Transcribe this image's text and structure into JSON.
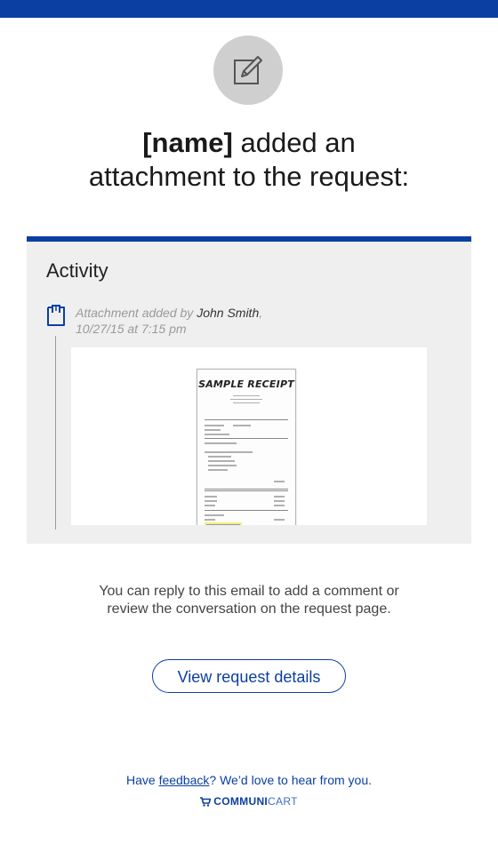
{
  "header": {
    "icon": "edit-icon",
    "name_placeholder": "[name]",
    "headline_rest": " added an",
    "headline_line2": "attachment to the request:"
  },
  "activity": {
    "title": "Activity",
    "icon": "clipboard-icon",
    "entry_prefix": "Attachment added by ",
    "author": "John Smith",
    "author_suffix": ",",
    "timestamp": "10/27/15 at 7:15 pm",
    "attachment": {
      "receipt_title": "SAMPLE RECEIPT"
    }
  },
  "reply": {
    "line1": "You can reply to this email to add a comment or",
    "line2": "review the conversation on the request page."
  },
  "button": {
    "label": "View request details"
  },
  "footer": {
    "pre": "Have ",
    "link": "feedback",
    "post": "? We’d love to hear from you.",
    "brand_bold": "COMMUNI",
    "brand_rest": "CART",
    "brand_icon": "cart-icon"
  },
  "colors": {
    "accent": "#0b3fa1",
    "panel": "#efefef",
    "icon_bg": "#cfcfcf"
  }
}
